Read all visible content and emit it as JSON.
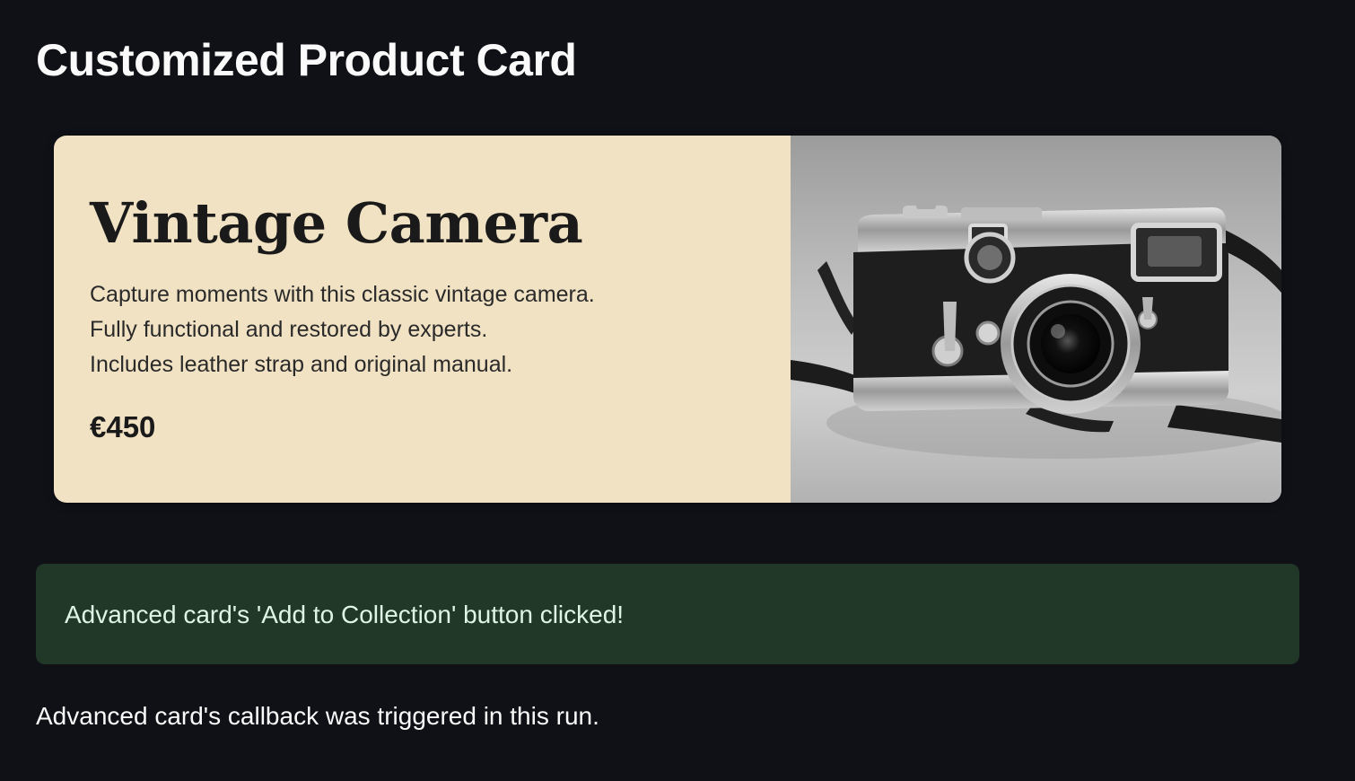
{
  "page": {
    "title": "Customized Product Card"
  },
  "card": {
    "title": "Vintage Camera",
    "description_lines": [
      "Capture moments with this classic vintage camera.",
      "Fully functional and restored by experts.",
      "Includes leather strap and original manual."
    ],
    "price": "€450",
    "background_color": "#f1e2c3",
    "image_icon": "vintage-camera-photo"
  },
  "alert": {
    "message": "Advanced card's 'Add to Collection' button clicked!",
    "background_color": "#213829"
  },
  "status": {
    "message": "Advanced card's callback was triggered in this run."
  },
  "theme": {
    "background": "#0f1117",
    "text": "#fafafa"
  }
}
